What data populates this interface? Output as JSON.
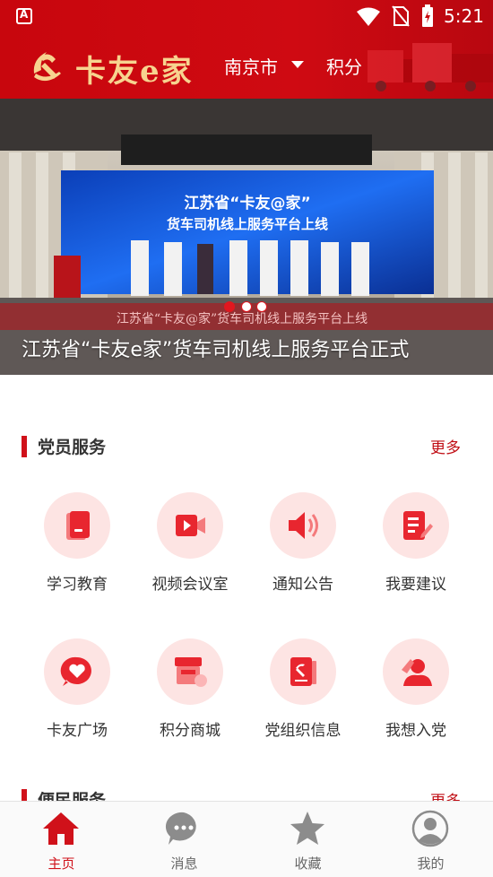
{
  "status_bar": {
    "time": "5:21"
  },
  "header": {
    "logo_text": "卡友e家",
    "city": "南京市",
    "points": "积分"
  },
  "banner": {
    "caption": "江苏省“卡友e家”货车司机线上服务平台正式",
    "screen_title": "江苏省“卡友@家”",
    "screen_subtitle": "货车司机线上服务平台上线",
    "floor_text": "江苏省“卡友@家”货车司机线上服务平台上线"
  },
  "party_services": {
    "title": "党员服务",
    "more": "更多",
    "items": [
      {
        "label": "学习教育",
        "icon": "book-icon"
      },
      {
        "label": "视频会议室",
        "icon": "video-icon"
      },
      {
        "label": "通知公告",
        "icon": "speaker-icon"
      },
      {
        "label": "我要建议",
        "icon": "edit-doc-icon"
      },
      {
        "label": "卡友广场",
        "icon": "heart-chat-icon"
      },
      {
        "label": "积分商城",
        "icon": "shop-icon"
      },
      {
        "label": "党组织信息",
        "icon": "party-book-icon"
      },
      {
        "label": "我想入党",
        "icon": "salute-icon"
      }
    ]
  },
  "civil_services": {
    "title": "便民服务",
    "more": "更多"
  },
  "bottom_nav": [
    {
      "label": "主页",
      "icon": "home-icon",
      "active": true
    },
    {
      "label": "消息",
      "icon": "message-icon",
      "active": false
    },
    {
      "label": "收藏",
      "icon": "star-icon",
      "active": false
    },
    {
      "label": "我的",
      "icon": "user-icon",
      "active": false
    }
  ],
  "colors": {
    "brand_red": "#d0111a",
    "icon_bg": "#fde4e3",
    "logo_gold": "#f7d38f"
  }
}
